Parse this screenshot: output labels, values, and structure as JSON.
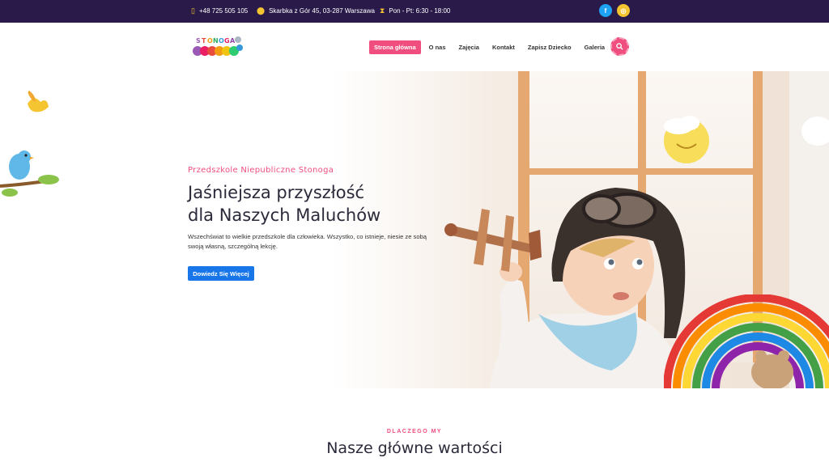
{
  "topbar": {
    "phone": "+48 725 505 105",
    "address": "Skarbka z Gór 45, 03-287 Warszawa",
    "hours": "Pon - Pt: 6:30 - 18:00",
    "phone_icon": "phone-icon",
    "address_icon": "map-pin-icon",
    "hours_icon": "hourglass-icon",
    "social": [
      {
        "name": "facebook-icon",
        "glyph": "f",
        "color": "#1da1f2"
      },
      {
        "name": "instagram-icon",
        "glyph": "◎",
        "color": "#f5c431"
      }
    ]
  },
  "header": {
    "logo_text": "STONOGA",
    "nav": [
      {
        "label": "Strona główna",
        "active": true
      },
      {
        "label": "O nas",
        "active": false
      },
      {
        "label": "Zajęcia",
        "active": false
      },
      {
        "label": "Kontakt",
        "active": false
      },
      {
        "label": "Zapisz Dziecko",
        "active": false
      },
      {
        "label": "Galeria",
        "active": false
      }
    ],
    "search_icon": "search-icon"
  },
  "hero": {
    "subtitle": "Przedszkole Niepubliczne Stonoga",
    "title_line1": "Jaśniejsza przyszłość",
    "title_line2": "dla Naszych Maluchów",
    "description": "Wszechświat to wielkie przedszkole dla człowieka. Wszystko, co istnieje, niesie ze sobą swoją własną, szczególną lekcję.",
    "button": "Dowiedz Się Więcej"
  },
  "why": {
    "eyebrow": "DLACZEGO MY",
    "title": "Nasze główne wartości"
  },
  "colors": {
    "topbar_bg": "#2a1a4a",
    "accent_pink": "#f04e7f",
    "button_blue": "#1976e8",
    "icon_yellow": "#f5c431"
  }
}
